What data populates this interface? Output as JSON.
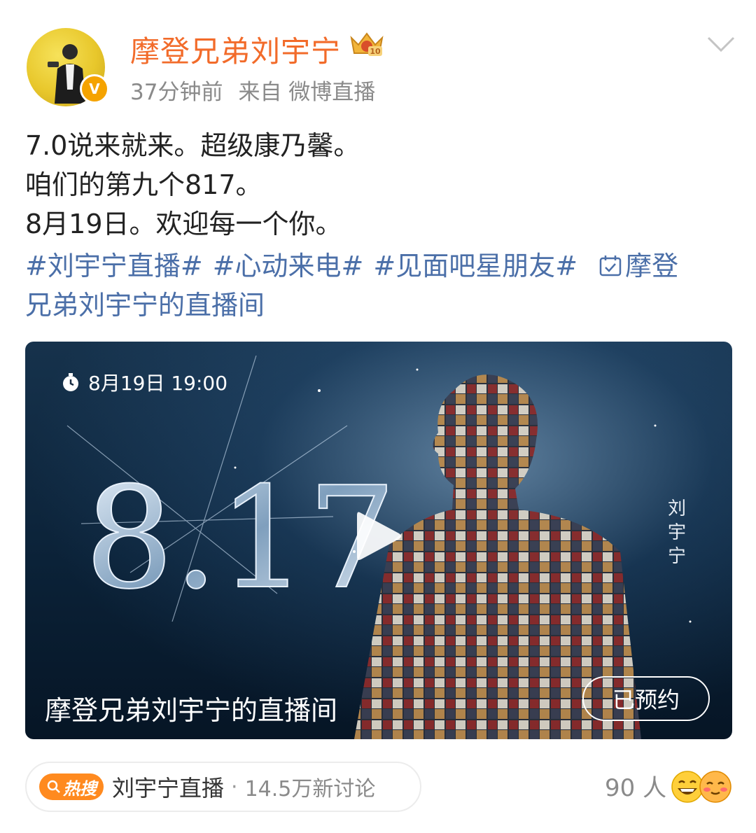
{
  "post": {
    "username": "摩登兄弟刘宇宁",
    "time_ago": "37分钟前",
    "source": "来自 微博直播",
    "text_lines": [
      "7.0说来就来。超级康乃馨。",
      "咱们的第九个817。",
      "8月19日。欢迎每一个你。"
    ],
    "hashtags": [
      "#刘宇宁直播#",
      "#心动来电#",
      "#见面吧星朋友#"
    ],
    "room_link": "摩登兄弟刘宇宁的直播间",
    "room_link_line1": "摩登",
    "room_link_line2": "兄弟刘宇宁的直播间"
  },
  "card": {
    "datetime": "8月19日 19:00",
    "side_text": "刘宇宁",
    "big_number": "8.17",
    "title": "摩登兄弟刘宇宁的直播间",
    "reserve_label": "已预约"
  },
  "footer": {
    "hot_badge": "热搜",
    "hot_topic": "刘宇宁直播",
    "hot_count": "14.5万新讨论",
    "reaction_count": "90 人"
  },
  "icons": {
    "avatar": "user-avatar",
    "verified": "verified-badge-icon",
    "crown": "vip-crown-icon",
    "menu": "chevron-down-icon",
    "room": "live-room-icon",
    "clock": "clock-icon",
    "play": "play-icon",
    "reaction1": "laughing-emoji-icon",
    "reaction2": "blush-emoji-icon"
  },
  "colors": {
    "username": "#f26b2a",
    "hashtag": "#4b6fa8",
    "hot_badge": "#ff8a1f"
  }
}
